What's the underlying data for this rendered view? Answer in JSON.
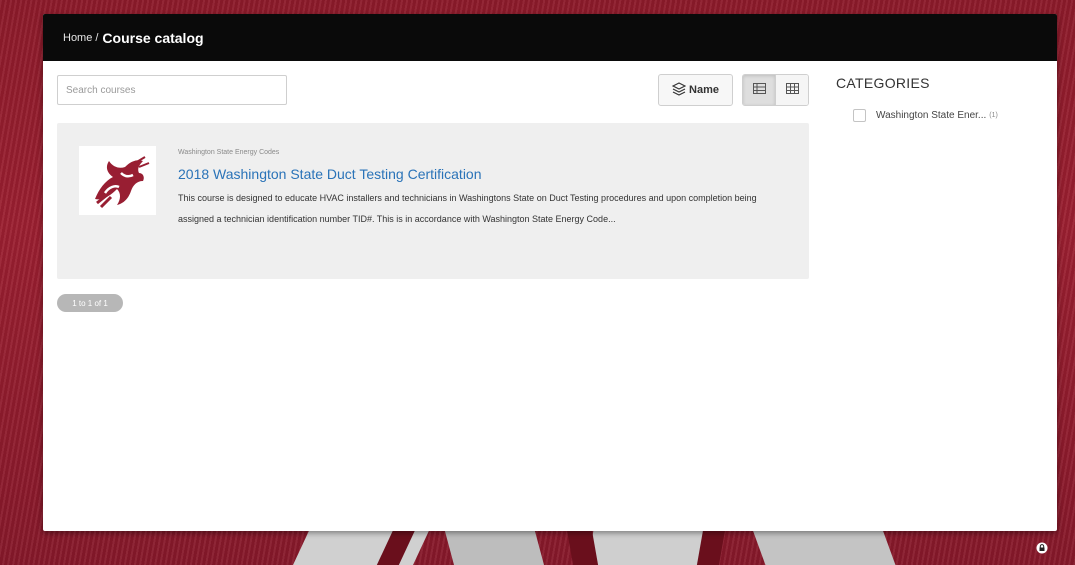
{
  "breadcrumb": {
    "home": "Home",
    "separator": "/",
    "current": "Course catalog"
  },
  "search": {
    "placeholder": "Search courses",
    "value": ""
  },
  "toolbar": {
    "sort_label": "Name",
    "sort_icon": "layers-icon",
    "view_list_icon": "list-view-icon",
    "view_grid_icon": "grid-view-icon"
  },
  "courses": [
    {
      "category": "Washington State Energy Codes",
      "title": "2018 Washington State Duct Testing Certification",
      "description": "This course is designed to educate HVAC installers and technicians in Washingtons State on Duct Testing procedures and upon completion being assigned a technician identification number TID#. This is in accordance with Washington State Energy Code...",
      "logo": "wsu-cougar-logo"
    }
  ],
  "pagination": {
    "label": "1 to 1 of 1"
  },
  "sidebar": {
    "heading": "CATEGORIES",
    "items": [
      {
        "label": "Washington State Ener...",
        "count": "(1)"
      }
    ]
  },
  "colors": {
    "topbar": "#0a0a0a",
    "link": "#2a73b8",
    "background": "#8c1a2a",
    "card": "#efefef"
  }
}
